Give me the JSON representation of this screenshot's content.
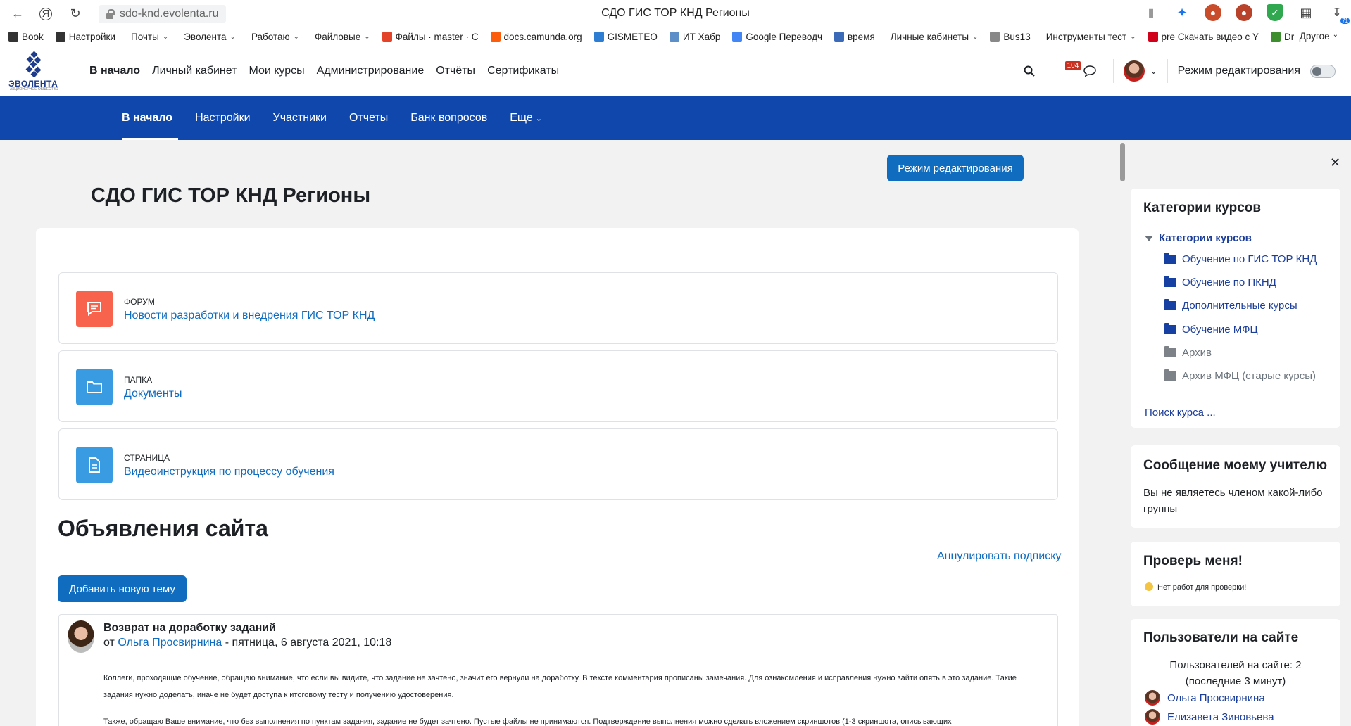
{
  "browser": {
    "url": "sdo-knd.evolenta.ru",
    "tab_title": "СДО ГИС ТОР КНД Регионы",
    "ext_badge": "71",
    "bookmarks": [
      {
        "label": "Book",
        "color": "#333333",
        "caret": ""
      },
      {
        "label": "Настройки",
        "color": "#333333",
        "caret": ""
      },
      {
        "label": "Почты",
        "color": "",
        "caret": "⌄"
      },
      {
        "label": "Эволента",
        "color": "",
        "caret": "⌄"
      },
      {
        "label": "Работаю",
        "color": "",
        "caret": "⌄"
      },
      {
        "label": "Файловые",
        "color": "",
        "caret": "⌄"
      },
      {
        "label": "Файлы · master · C",
        "color": "#e24329",
        "caret": ""
      },
      {
        "label": "docs.camunda.org",
        "color": "#fc5d0d",
        "caret": ""
      },
      {
        "label": "GISMETEO",
        "color": "#2d7dd2",
        "caret": ""
      },
      {
        "label": "ИТ Хабр",
        "color": "#5c8ec7",
        "caret": ""
      },
      {
        "label": "Google Переводч",
        "color": "#4285f4",
        "caret": ""
      },
      {
        "label": "время",
        "color": "#3a6ab8",
        "caret": ""
      },
      {
        "label": "Личные кабинеты",
        "color": "",
        "caret": "⌄"
      },
      {
        "label": "Bus13",
        "color": "#888888",
        "caret": ""
      },
      {
        "label": "Инструменты тест",
        "color": "",
        "caret": "⌄"
      },
      {
        "label": "pre Скачать видео с Y",
        "color": "#d0021b",
        "caret": ""
      },
      {
        "label": "Dr",
        "color": "#3e8e2f",
        "caret": ""
      }
    ],
    "bookmarks_other": "Другое"
  },
  "topnav": {
    "logo_name": "ЭВОЛЕНТА",
    "logo_sub": "АКЦИОНЕРНОЕ ОБЩЕСТВО",
    "menu": [
      "В начало",
      "Личный кабинет",
      "Мои курсы",
      "Администрирование",
      "Отчёты",
      "Сертификаты"
    ],
    "notifications_count": "104",
    "edit_mode_label": "Режим редактирования"
  },
  "secnav": {
    "items": [
      "В начало",
      "Настройки",
      "Участники",
      "Отчеты",
      "Банк вопросов",
      "Еще"
    ]
  },
  "main": {
    "edit_mode_button": "Режим редактирования",
    "page_title": "СДО ГИС ТОР КНД Регионы",
    "activities": [
      {
        "type": "Форум",
        "name": "Новости разработки и внедрения ГИС ТОР КНД",
        "color": "#f7634d"
      },
      {
        "type": "Папка",
        "name": "Документы",
        "color": "#399be2"
      },
      {
        "type": "Страница",
        "name": "Видеоинструкция по процессу обучения",
        "color": "#399be2"
      }
    ],
    "announcements_title": "Объявления сайта",
    "unsubscribe": "Аннулировать подписку",
    "add_topic": "Добавить новую тему",
    "post": {
      "title": "Возврат на доработку заданий",
      "by": "от",
      "author": "Ольга Просвирнина",
      "date": "- пятница, 6 августа 2021, 10:18",
      "para1": "Коллеги, проходящие обучение, обращаю внимание, что если вы видите, что задание не зачтено, значит его вернули на доработку. В тексте комментария прописаны замечания. Для ознакомления и исправления нужно зайти опять в это задание. Такие задания нужно доделать, иначе не будет доступа к итоговому тесту и получению удостоверения.",
      "para2": "Также, обращаю Ваше внимание, что без выполнения по пунктам  задания, задание не будет зачтено. Пустые файлы не принимаются.  Подтверждение выполнения можно сделать вложением скриншотов (1-3 скриншота, описывающих"
    }
  },
  "drawer": {
    "categories_title": "Категории курсов",
    "categories_root": "Категории курсов",
    "categories": [
      {
        "name": "Обучение по ГИС ТОР КНД",
        "visible": true
      },
      {
        "name": "Обучение по ПКНД",
        "visible": true
      },
      {
        "name": "Дополнительные курсы",
        "visible": true
      },
      {
        "name": "Обучение МФЦ",
        "visible": true
      },
      {
        "name": "Архив",
        "visible": false
      },
      {
        "name": "Архив МФЦ (старые курсы)",
        "visible": false
      }
    ],
    "search_course": "Поиск курса ...",
    "message_title": "Сообщение моему учителю",
    "message_text": "Вы не являетесь членом какой-либо группы",
    "check_title": "Проверь меня!",
    "check_text": "Нет работ для проверки!",
    "online_title": "Пользователи на сайте",
    "online_count": "Пользователей на сайте: 2",
    "online_period": "(последние 3 минут)",
    "online_users": [
      "Ольга Просвирнина",
      "Елизавета Зиновьева"
    ]
  }
}
